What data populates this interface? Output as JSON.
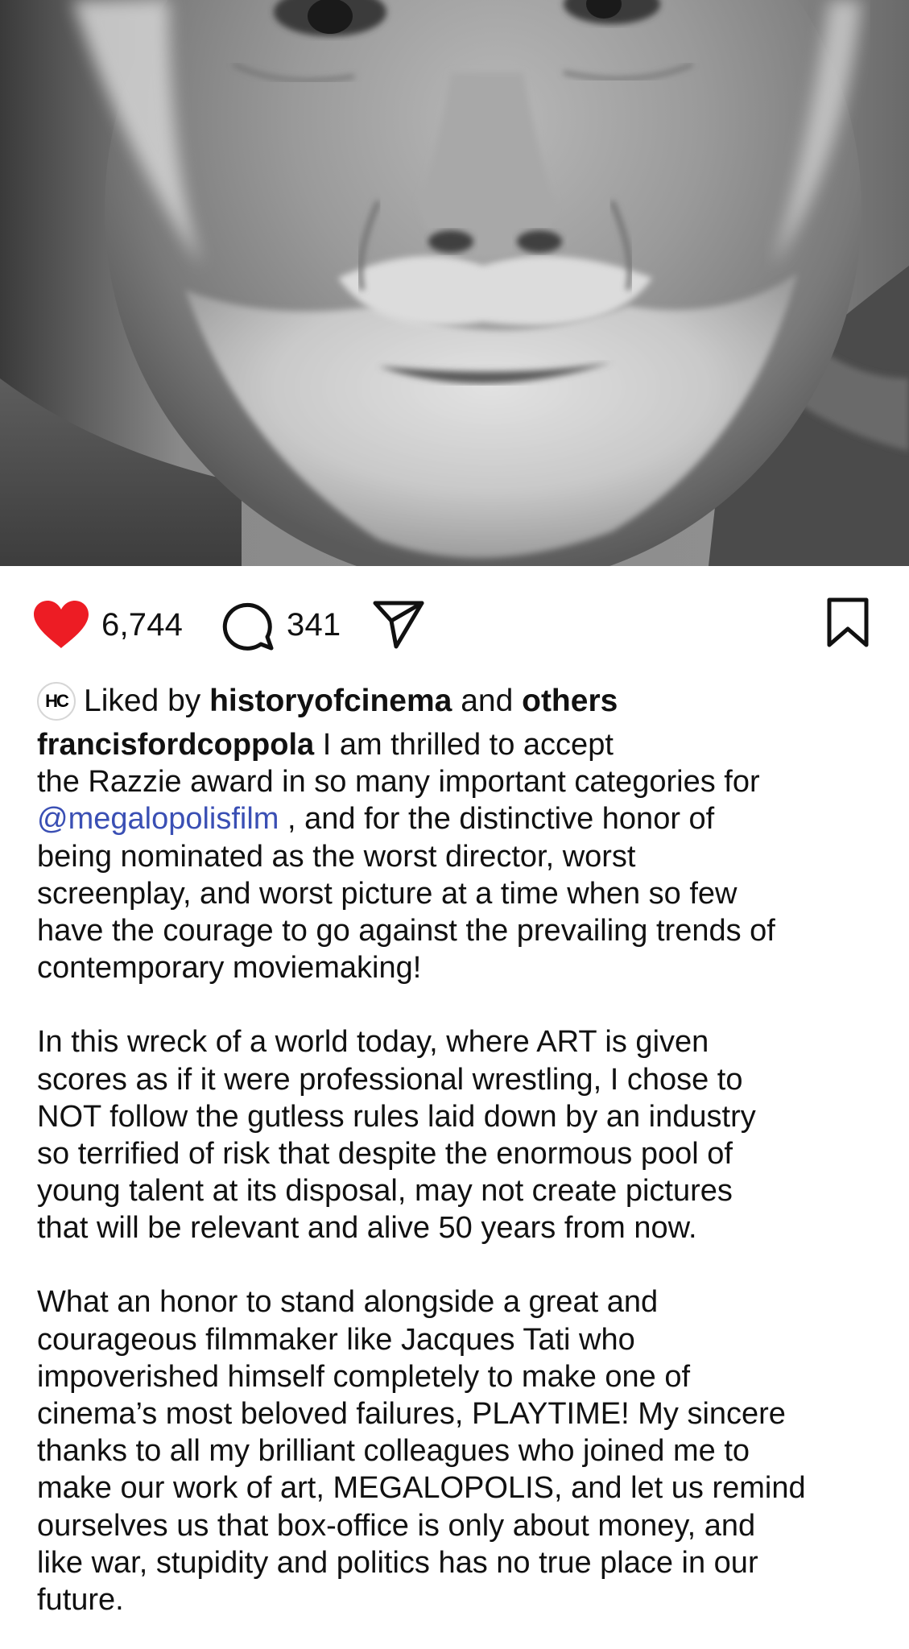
{
  "post": {
    "image_alt": "Black and white close-up portrait photo",
    "actions": {
      "like_count": "6,744",
      "comment_count": "341",
      "like_icon": "heart-filled-icon",
      "comment_icon": "speech-bubble-icon",
      "share_icon": "paper-plane-icon",
      "save_icon": "bookmark-icon",
      "like_color": "#ed1c24"
    },
    "liked_by": {
      "avatar_text": "HC",
      "prefix": "Liked by",
      "user": "historyofcinema",
      "joiner": "and",
      "others": "others"
    },
    "caption": {
      "username": "francisfordcoppola",
      "mention": "@megalopolisfilm",
      "mention_color": "#3a4fb4",
      "line1_rest": " I am thrilled to accept",
      "line2": "the Razzie award in so many important categories for",
      "line3_rest": " , and for the distinctive honor of",
      "line4": "being nominated as the worst director, worst",
      "line5": "screenplay, and worst picture at a time when so few",
      "line6": "have the courage to go against the prevailing trends of",
      "line7": "contemporary moviemaking!",
      "p2": [
        "In this wreck of a world today, where ART is given",
        "scores as if it were professional wrestling, I chose to",
        "NOT follow the gutless rules laid down by an industry",
        "so terrified of risk that despite the enormous pool of",
        "young talent at its disposal, may not create pictures",
        "that will be relevant and alive 50 years from now."
      ],
      "p3": [
        "What an honor to stand alongside a great and",
        "courageous filmmaker like Jacques Tati who",
        "impoverished himself completely to make one of",
        "cinema’s most beloved failures, PLAYTIME! My sincere",
        "thanks to all my brilliant colleagues who joined me to",
        "make our work of art, MEGALOPOLIS, and let us remind",
        "ourselves us that box-office is only about money, and",
        "like war, stupidity and politics has no true place in our",
        "future."
      ]
    }
  }
}
